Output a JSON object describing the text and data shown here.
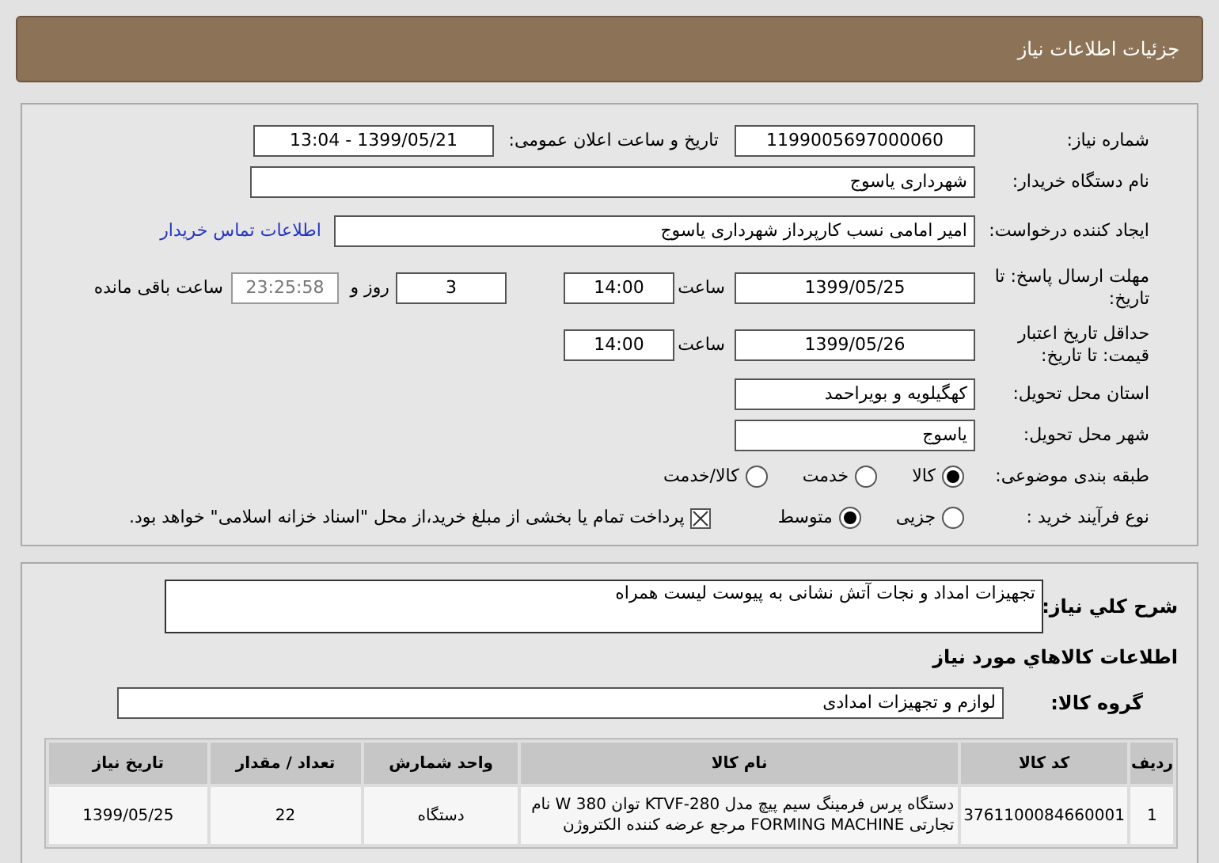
{
  "window": {
    "title": "جزئیات اطلاعات نیاز"
  },
  "need_number": {
    "label": "شماره نیاز:",
    "value": "1199005697000060"
  },
  "announce": {
    "label": "تاریخ و ساعت اعلان عمومی:",
    "value": "1399/05/21 - 13:04"
  },
  "buyer": {
    "label": "نام دستگاه خریدار:",
    "value": "شهرداری یاسوج"
  },
  "creator": {
    "label": "ایجاد کننده درخواست:",
    "value": "امیر امامی نسب کارپرداز شهرداری یاسوج",
    "link": "اطلاعات تماس خریدار"
  },
  "reply_deadline": {
    "label": "مهلت ارسال پاسخ: تا تاریخ:",
    "date": "1399/05/25",
    "time_label": "ساعت",
    "time": "14:00",
    "days": "3",
    "days_label": "روز و",
    "remaining": "23:25:58",
    "remaining_label": "ساعت باقی مانده"
  },
  "price_validity": {
    "label": "حداقل تاریخ اعتبار قیمت: تا تاریخ:",
    "date": "1399/05/26",
    "time_label": "ساعت",
    "time": "14:00"
  },
  "province": {
    "label": "استان محل تحویل:",
    "value": "کهگیلویه و بویراحمد"
  },
  "city": {
    "label": "شهر محل تحویل:",
    "value": "یاسوج"
  },
  "category": {
    "label": "طبقه بندی موضوعی:",
    "options": [
      {
        "label": "کالا",
        "selected": true
      },
      {
        "label": "خدمت",
        "selected": false
      },
      {
        "label": "کالا/خدمت",
        "selected": false
      }
    ]
  },
  "process": {
    "label": "نوع فرآیند خرید :",
    "options": [
      {
        "label": "جزیی",
        "selected": false
      },
      {
        "label": "متوسط",
        "selected": true
      }
    ],
    "payment": {
      "label": "پرداخت تمام یا بخشی از مبلغ خرید،از محل \"اسناد خزانه اسلامی\" خواهد بود.",
      "checked": true
    }
  },
  "description": {
    "label": "شرح کلي نياز:",
    "value": "تجهیزات امداد و نجات آتش نشانی به پیوست لیست همراه"
  },
  "goods_heading": "اطلاعات کالاهاي مورد نياز",
  "goods_group": {
    "label": "گروه کالا:",
    "value": "لوازم و تجهیزات امدادی"
  },
  "table": {
    "columns": [
      "ردیف",
      "کد کالا",
      "نام کالا",
      "واحد شمارش",
      "تعداد / مقدار",
      "تاریخ نیاز"
    ],
    "rows": [
      {
        "cells": [
          "1",
          "3761100084660001",
          "دستگاه پرس فرمینگ سیم پیچ مدل KTVF-280 توان 380 W نام تجارتی FORMING MACHINE مرجع عرضه کننده الکتروژن",
          "دستگاه",
          "22",
          "1399/05/25"
        ]
      }
    ]
  }
}
